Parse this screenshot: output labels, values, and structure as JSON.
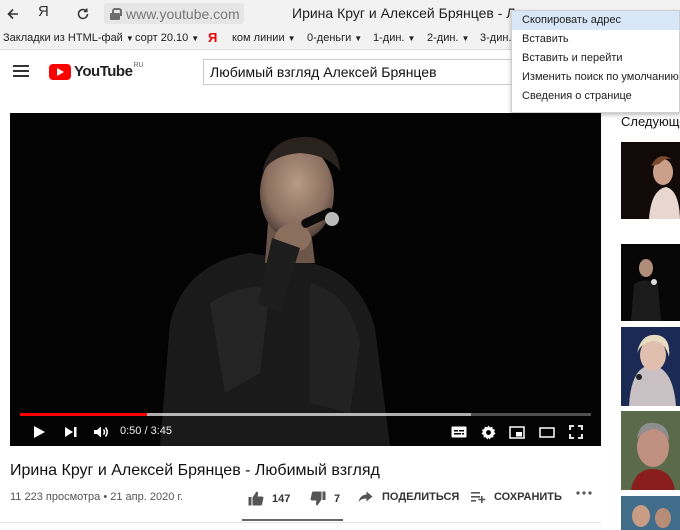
{
  "browser": {
    "back_icon": "arrow-left",
    "yandex_letter": "Я",
    "reload_icon": "reload",
    "address": "www.youtube.com",
    "tab_title": "Ирина Круг и Алексей Брянцев - Любимый взгляд - YouTube"
  },
  "bookmarks": [
    {
      "label": "Закладки из HTML-фай"
    },
    {
      "label": "сорт 20.10"
    },
    {
      "label": "Я"
    },
    {
      "label": "ком линии"
    },
    {
      "label": "0-деньги"
    },
    {
      "label": "1-дин."
    },
    {
      "label": "2-дин."
    },
    {
      "label": "3-дин."
    }
  ],
  "youtube": {
    "logo_text": "YouTube",
    "logo_region": "RU",
    "search_value": "Любимый взгляд Алексей Брянцев"
  },
  "context_menu": {
    "items": [
      {
        "label": "Скопировать адрес",
        "active": true
      },
      {
        "label": "Вставить"
      },
      {
        "label": "Вставить и перейти"
      },
      {
        "label": "Изменить поиск по умолчанию"
      },
      {
        "label": "Сведения о странице"
      }
    ]
  },
  "player": {
    "current_time": "0:50",
    "duration": "3:45",
    "time_display": "0:50 / 3:45",
    "played_fraction": 0.222,
    "buffered_fraction": 0.79,
    "progress_color": "#ff0000"
  },
  "video": {
    "title": "Ирина Круг и Алексей Брянцев - Любимый взгляд",
    "views_date": "11 223 просмотра • 21 апр. 2020 г.",
    "likes": "147",
    "dislikes": "7",
    "share_label": "ПОДЕЛИТЬСЯ",
    "save_label": "СОХРАНИТЬ",
    "more_icon": "more-horizontal"
  },
  "sidebar": {
    "next_label": "Следующее"
  }
}
